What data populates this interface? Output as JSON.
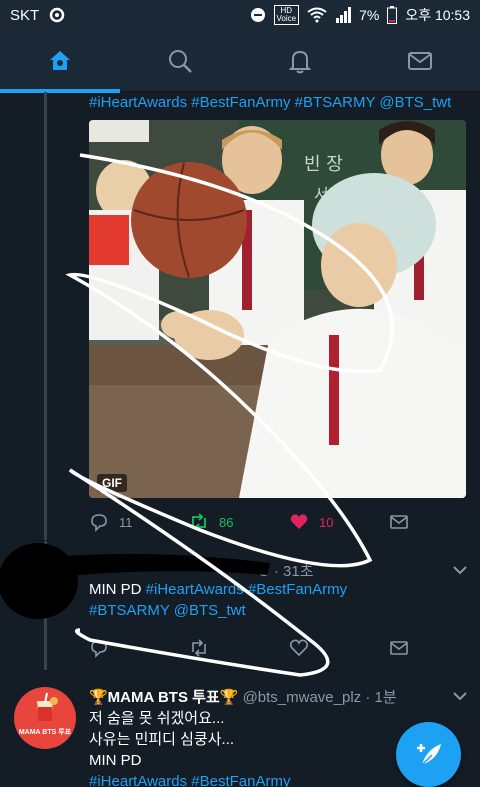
{
  "status_bar": {
    "carrier": "SKT",
    "hd_badge_top": "HD",
    "hd_badge_bottom": "Voice",
    "battery": "7%",
    "time": "오후 10:53"
  },
  "nav": {
    "tabs": [
      "home",
      "search",
      "notifications",
      "messages"
    ],
    "active_tab": "home"
  },
  "tweet1": {
    "hashtags": "#iHeartAwards #BestFanArmy #BTSARMY @BTS_twt",
    "media_badge": "GIF",
    "actions": {
      "replies": "11",
      "retweets": "86",
      "likes": "10"
    }
  },
  "tweet2": {
    "head_visible": "G · 31초",
    "text_plain": "MIN PD ",
    "text_links_line1": "#iHeartAwards #BestFanArmy",
    "text_links_line2": "#BTSARMY @BTS_twt"
  },
  "tweet3": {
    "name": "🏆MAMA BTS 투표🏆",
    "handle_time": "@bts_mwave_plz · 1분",
    "avatar_label": "MAMA BTS 투표",
    "lines": [
      "저 숨을 못 쉬겠어요...",
      "사유는 민피디 심쿵사...",
      "MIN PD"
    ],
    "hashtags": "#iHeartAwards #BestFanArmy"
  },
  "colors": {
    "background": "#141d26",
    "bar": "#1b2836",
    "accent": "#1da1f2",
    "retweet": "#17bf63",
    "like": "#e0245e",
    "muted": "#8899a6"
  },
  "icons": {
    "nav_home": "home-icon",
    "nav_search": "search-icon",
    "nav_notifications": "bell-icon",
    "nav_messages": "mail-icon",
    "reply": "reply-icon",
    "retweet": "retweet-icon",
    "like": "heart-icon",
    "dm": "mail-icon",
    "compose": "compose-feather-icon"
  }
}
